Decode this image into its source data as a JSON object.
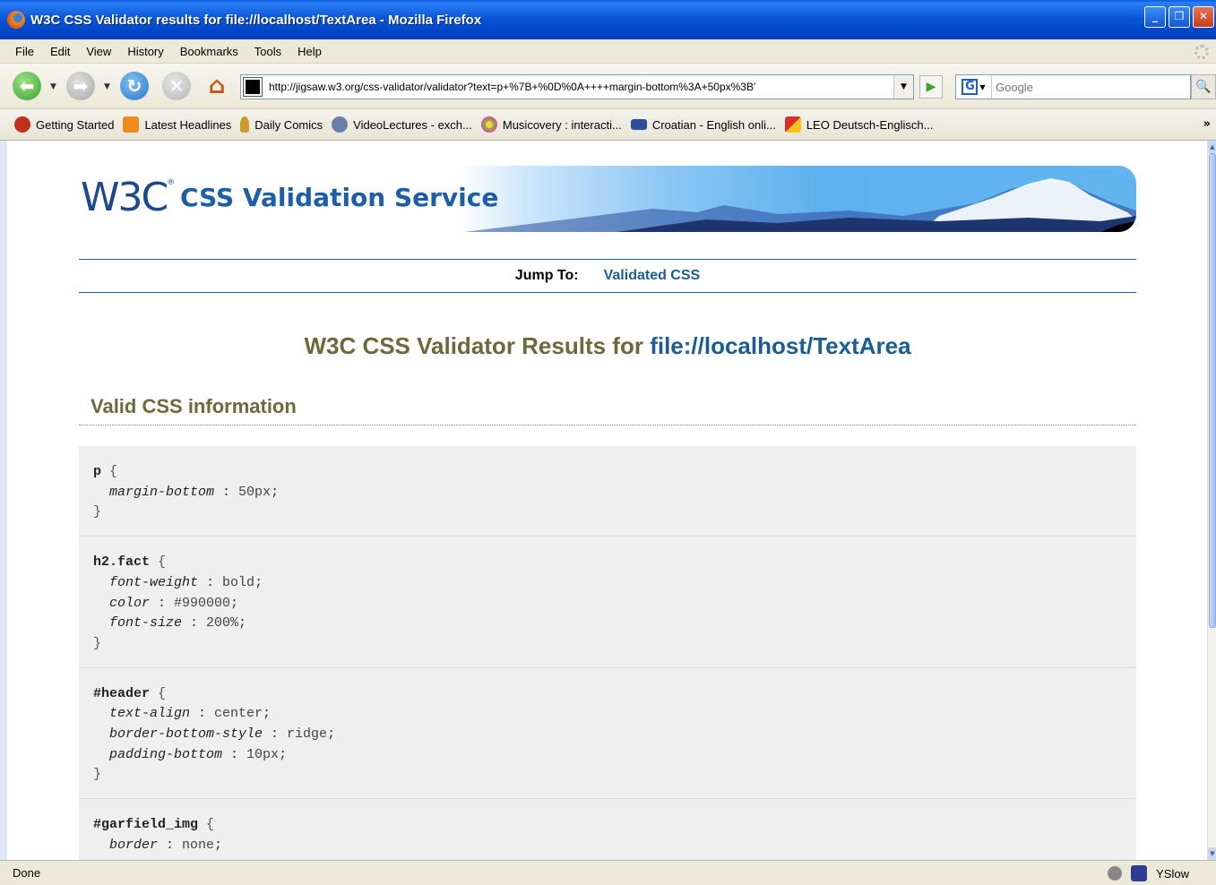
{
  "window": {
    "title": "W3C CSS Validator results for file://localhost/TextArea - Mozilla Firefox",
    "min_glyph": "_",
    "max_glyph": "❐",
    "close_glyph": "✕"
  },
  "menubar": {
    "items": [
      "File",
      "Edit",
      "View",
      "History",
      "Bookmarks",
      "Tools",
      "Help"
    ]
  },
  "navbar": {
    "back_glyph": "⬅",
    "forward_glyph": "➡",
    "reload_glyph": "↻",
    "stop_glyph": "✕",
    "home_glyph": "⌂",
    "url": "http://jigsaw.w3.org/css-validator/validator?text=p+%7B+%0D%0A++++margin-bottom%3A+50px%3B'",
    "url_dropdown_glyph": "▼",
    "go_glyph": "▶",
    "search_engine_letter": "G",
    "search_placeholder": "Google",
    "search_button_glyph": "🔍"
  },
  "bookmarks": {
    "items": [
      {
        "label": "Getting Started",
        "color": "#c0301a"
      },
      {
        "label": "Latest Headlines",
        "color": "#f08a1a"
      },
      {
        "label": "Daily Comics",
        "color": "#c89a2a"
      },
      {
        "label": "VideoLectures - exch...",
        "color": "#6a7fa8"
      },
      {
        "label": "Musicovery : interacti...",
        "color": "#7ac23a"
      },
      {
        "label": "Croatian - English onli...",
        "color": "#2f4f9e"
      },
      {
        "label": "LEO Deutsch-Englisch...",
        "color": "#d8302a"
      }
    ],
    "overflow_glyph": "»"
  },
  "page": {
    "banner": {
      "logo": "W3C",
      "logo_mark": "®",
      "service_name": "CSS Validation Service"
    },
    "jump": {
      "label": "Jump To:",
      "link": "Validated CSS"
    },
    "results_title_prefix": "W3C CSS Validator Results for ",
    "results_title_link": "file://localhost/TextArea",
    "section_title": "Valid CSS information",
    "rules": [
      {
        "selector": "p",
        "decls": [
          {
            "prop": "margin-bottom",
            "val": "50px"
          }
        ]
      },
      {
        "selector": "h2.fact",
        "decls": [
          {
            "prop": "font-weight",
            "val": "bold"
          },
          {
            "prop": "color",
            "val": "#990000"
          },
          {
            "prop": "font-size",
            "val": "200%"
          }
        ]
      },
      {
        "selector": "#header",
        "decls": [
          {
            "prop": "text-align",
            "val": "center"
          },
          {
            "prop": "border-bottom-style",
            "val": "ridge"
          },
          {
            "prop": "padding-bottom",
            "val": "10px"
          }
        ]
      },
      {
        "selector": "#garfield_img",
        "decls": [
          {
            "prop": "border",
            "val": "none"
          }
        ]
      }
    ]
  },
  "statusbar": {
    "status": "Done",
    "yslow": "YSlow"
  }
}
